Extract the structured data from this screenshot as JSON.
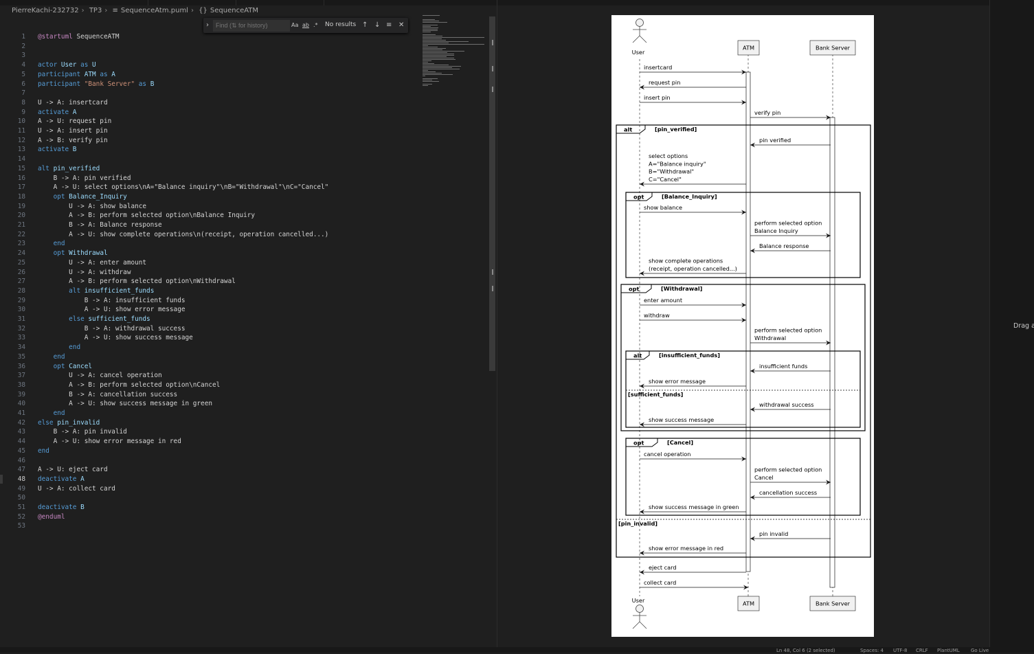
{
  "breadcrumb": {
    "folder1": "PierreKachi-232732",
    "folder2": "TP3",
    "file": "SequenceAtm.puml",
    "symbol": "SequenceATM",
    "file_icon": "file-lines-icon",
    "symbol_icon": "braces-icon"
  },
  "find": {
    "placeholder": "Find (⇅ for history)",
    "match_case": "Aa",
    "whole_word": "ab",
    "regex": ".*",
    "result": "No results",
    "prev": "↑",
    "next": "↓",
    "selection": "≡",
    "close": "✕",
    "toggle": "›"
  },
  "editor": {
    "current_line": 48,
    "lines": [
      {
        "n": "1",
        "segs": [
          {
            "t": "@startuml",
            "c": "start"
          },
          {
            "t": " SequenceATM",
            "c": ""
          }
        ]
      },
      {
        "n": "2",
        "segs": []
      },
      {
        "n": "3",
        "segs": []
      },
      {
        "n": "4",
        "segs": [
          {
            "t": "actor",
            "c": "kw"
          },
          {
            "t": " User ",
            "c": "id"
          },
          {
            "t": "as",
            "c": "kw"
          },
          {
            "t": " U",
            "c": "id"
          }
        ]
      },
      {
        "n": "5",
        "segs": [
          {
            "t": "participant",
            "c": "kw"
          },
          {
            "t": " ATM ",
            "c": "id"
          },
          {
            "t": "as",
            "c": "kw"
          },
          {
            "t": " A",
            "c": "id"
          }
        ]
      },
      {
        "n": "6",
        "segs": [
          {
            "t": "participant",
            "c": "kw"
          },
          {
            "t": " \"Bank Server\" ",
            "c": "str"
          },
          {
            "t": "as",
            "c": "kw"
          },
          {
            "t": " B",
            "c": "id"
          }
        ]
      },
      {
        "n": "7",
        "segs": []
      },
      {
        "n": "8",
        "segs": [
          {
            "t": "U -> A: insertcard",
            "c": ""
          }
        ]
      },
      {
        "n": "9",
        "segs": [
          {
            "t": "activate",
            "c": "kw"
          },
          {
            "t": " A",
            "c": "id"
          }
        ]
      },
      {
        "n": "10",
        "segs": [
          {
            "t": "A -> U: request pin",
            "c": ""
          }
        ]
      },
      {
        "n": "11",
        "segs": [
          {
            "t": "U -> A: insert pin",
            "c": ""
          }
        ]
      },
      {
        "n": "12",
        "segs": [
          {
            "t": "A -> B: verify pin",
            "c": ""
          }
        ]
      },
      {
        "n": "13",
        "segs": [
          {
            "t": "activate",
            "c": "kw"
          },
          {
            "t": " B",
            "c": "id"
          }
        ]
      },
      {
        "n": "14",
        "segs": []
      },
      {
        "n": "15",
        "segs": [
          {
            "t": "alt",
            "c": "kw"
          },
          {
            "t": " pin_verified",
            "c": "id"
          }
        ]
      },
      {
        "n": "16",
        "segs": [
          {
            "t": "    B -> A: pin verified",
            "c": ""
          }
        ]
      },
      {
        "n": "17",
        "segs": [
          {
            "t": "    A -> U: select options\\nA=\"Balance inquiry\"\\nB=\"Withdrawal\"\\nC=\"Cancel\"",
            "c": ""
          }
        ]
      },
      {
        "n": "18",
        "segs": [
          {
            "t": "    opt",
            "c": "kw"
          },
          {
            "t": " Balance_Inquiry",
            "c": "id"
          }
        ]
      },
      {
        "n": "19",
        "segs": [
          {
            "t": "        U -> A: show balance",
            "c": ""
          }
        ]
      },
      {
        "n": "20",
        "segs": [
          {
            "t": "        A -> B: perform selected option\\nBalance Inquiry",
            "c": ""
          }
        ]
      },
      {
        "n": "21",
        "segs": [
          {
            "t": "        B -> A: Balance response",
            "c": ""
          }
        ]
      },
      {
        "n": "22",
        "segs": [
          {
            "t": "        A -> U: show complete operations\\n(receipt, operation cancelled...)",
            "c": ""
          }
        ]
      },
      {
        "n": "23",
        "segs": [
          {
            "t": "    end",
            "c": "kw"
          }
        ]
      },
      {
        "n": "24",
        "segs": [
          {
            "t": "    opt",
            "c": "kw"
          },
          {
            "t": " Withdrawal",
            "c": "id"
          }
        ]
      },
      {
        "n": "25",
        "segs": [
          {
            "t": "        U -> A: enter amount",
            "c": ""
          }
        ]
      },
      {
        "n": "26",
        "segs": [
          {
            "t": "        U -> A: withdraw",
            "c": ""
          }
        ]
      },
      {
        "n": "27",
        "segs": [
          {
            "t": "        A -> B: perform selected option\\nWithdrawal",
            "c": ""
          }
        ]
      },
      {
        "n": "28",
        "segs": [
          {
            "t": "        alt",
            "c": "kw"
          },
          {
            "t": " insufficient_funds",
            "c": "id"
          }
        ]
      },
      {
        "n": "29",
        "segs": [
          {
            "t": "            B -> A: insufficient funds",
            "c": ""
          }
        ]
      },
      {
        "n": "30",
        "segs": [
          {
            "t": "            A -> U: show error message",
            "c": ""
          }
        ]
      },
      {
        "n": "31",
        "segs": [
          {
            "t": "        else",
            "c": "kw"
          },
          {
            "t": " sufficient_funds",
            "c": "id"
          }
        ]
      },
      {
        "n": "32",
        "segs": [
          {
            "t": "            B -> A: withdrawal success",
            "c": ""
          }
        ]
      },
      {
        "n": "33",
        "segs": [
          {
            "t": "            A -> U: show success message",
            "c": ""
          }
        ]
      },
      {
        "n": "34",
        "segs": [
          {
            "t": "        end",
            "c": "kw"
          }
        ]
      },
      {
        "n": "35",
        "segs": [
          {
            "t": "    end",
            "c": "kw"
          }
        ]
      },
      {
        "n": "36",
        "segs": [
          {
            "t": "    opt",
            "c": "kw"
          },
          {
            "t": " Cancel",
            "c": "id"
          }
        ]
      },
      {
        "n": "37",
        "segs": [
          {
            "t": "        U -> A: cancel operation",
            "c": ""
          }
        ]
      },
      {
        "n": "38",
        "segs": [
          {
            "t": "        A -> B: perform selected option\\nCancel",
            "c": ""
          }
        ]
      },
      {
        "n": "39",
        "segs": [
          {
            "t": "        B -> A: cancellation success",
            "c": ""
          }
        ]
      },
      {
        "n": "40",
        "segs": [
          {
            "t": "        A -> U: show success message in green",
            "c": ""
          }
        ]
      },
      {
        "n": "41",
        "segs": [
          {
            "t": "    end",
            "c": "kw"
          }
        ]
      },
      {
        "n": "42",
        "segs": [
          {
            "t": "else",
            "c": "kw"
          },
          {
            "t": " pin_invalid",
            "c": "id"
          }
        ]
      },
      {
        "n": "43",
        "segs": [
          {
            "t": "    B -> A: pin invalid",
            "c": ""
          }
        ]
      },
      {
        "n": "44",
        "segs": [
          {
            "t": "    A -> U: show error message in red",
            "c": ""
          }
        ]
      },
      {
        "n": "45",
        "segs": [
          {
            "t": "end",
            "c": "kw"
          }
        ]
      },
      {
        "n": "46",
        "segs": []
      },
      {
        "n": "47",
        "segs": [
          {
            "t": "A -> U: eject card",
            "c": ""
          }
        ]
      },
      {
        "n": "48",
        "segs": [
          {
            "t": "deactivate",
            "c": "kw"
          },
          {
            "t": " A",
            "c": "id"
          }
        ]
      },
      {
        "n": "49",
        "segs": [
          {
            "t": "U -> A: collect card",
            "c": ""
          }
        ]
      },
      {
        "n": "50",
        "segs": []
      },
      {
        "n": "51",
        "segs": [
          {
            "t": "deactivate",
            "c": "kw"
          },
          {
            "t": " B",
            "c": "id"
          }
        ]
      },
      {
        "n": "52",
        "segs": [
          {
            "t": "@enduml",
            "c": "start"
          }
        ]
      },
      {
        "n": "53",
        "segs": []
      }
    ]
  },
  "diagram": {
    "participants": {
      "user": "User",
      "atm": "ATM",
      "bank": "Bank Server"
    },
    "messages": [
      {
        "text": [
          "insertcard"
        ],
        "from": "U",
        "to": "A"
      },
      {
        "text": [
          "request pin"
        ],
        "from": "A",
        "to": "U"
      },
      {
        "text": [
          "insert pin"
        ],
        "from": "U",
        "to": "A"
      },
      {
        "text": [
          "verify pin"
        ],
        "from": "A",
        "to": "B"
      },
      {
        "text": [
          "pin verified"
        ],
        "from": "B",
        "to": "A"
      },
      {
        "text": [
          "select options",
          "A=\"Balance inquiry\"",
          "B=\"Withdrawal\"",
          "C=\"Cancel\""
        ],
        "from": "A",
        "to": "U"
      },
      {
        "text": [
          "show balance"
        ],
        "from": "U",
        "to": "A"
      },
      {
        "text": [
          "perform selected option",
          "Balance Inquiry"
        ],
        "from": "A",
        "to": "B"
      },
      {
        "text": [
          "Balance response"
        ],
        "from": "B",
        "to": "A"
      },
      {
        "text": [
          "show complete operations",
          "(receipt, operation cancelled...)"
        ],
        "from": "A",
        "to": "U"
      },
      {
        "text": [
          "enter amount"
        ],
        "from": "U",
        "to": "A"
      },
      {
        "text": [
          "withdraw"
        ],
        "from": "U",
        "to": "A"
      },
      {
        "text": [
          "perform selected option",
          "Withdrawal"
        ],
        "from": "A",
        "to": "B"
      },
      {
        "text": [
          "insufficient funds"
        ],
        "from": "B",
        "to": "A"
      },
      {
        "text": [
          "show error message"
        ],
        "from": "A",
        "to": "U"
      },
      {
        "text": [
          "withdrawal success"
        ],
        "from": "B",
        "to": "A"
      },
      {
        "text": [
          "show success message"
        ],
        "from": "A",
        "to": "U"
      },
      {
        "text": [
          "cancel operation"
        ],
        "from": "U",
        "to": "A"
      },
      {
        "text": [
          "perform selected option",
          "Cancel"
        ],
        "from": "A",
        "to": "B"
      },
      {
        "text": [
          "cancellation success"
        ],
        "from": "B",
        "to": "A"
      },
      {
        "text": [
          "show success message in green"
        ],
        "from": "A",
        "to": "U"
      },
      {
        "text": [
          "pin invalid"
        ],
        "from": "B",
        "to": "A"
      },
      {
        "text": [
          "show error message in red"
        ],
        "from": "A",
        "to": "U"
      },
      {
        "text": [
          "eject card"
        ],
        "from": "A",
        "to": "U"
      },
      {
        "text": [
          "collect card"
        ],
        "from": "U",
        "to": "A"
      }
    ],
    "fragments": [
      {
        "kind": "alt",
        "guard": "[pin_verified]",
        "else_guard": "[pin_invalid]"
      },
      {
        "kind": "opt",
        "guard": "[Balance_Inquiry]"
      },
      {
        "kind": "opt",
        "guard": "[Withdrawal]"
      },
      {
        "kind": "alt",
        "guard": "[insufficient_funds]",
        "else_guard": "[sufficient_funds]"
      },
      {
        "kind": "opt",
        "guard": "[Cancel]"
      }
    ]
  },
  "right_panel": {
    "hint": "Drag a"
  },
  "status": {
    "position": "Ln 48, Col 6 (2 selected)",
    "spaces": "Spaces: 4",
    "encoding": "UTF-8",
    "eol": "CRLF",
    "language": "PlantUML",
    "golive": "Go Live"
  }
}
